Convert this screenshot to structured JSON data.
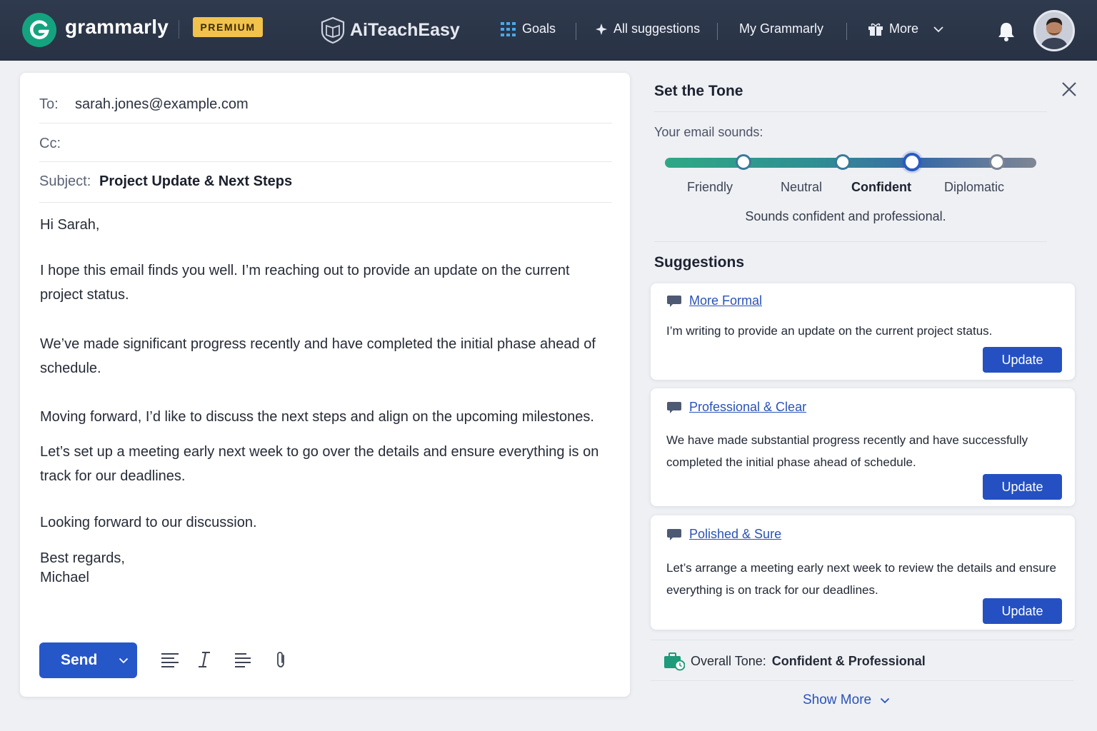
{
  "topbar": {
    "brand": "grammarly",
    "premium_badge": "PREMIUM",
    "partner_brand": "AiTeachEasy",
    "nav": [
      {
        "label": "Goals",
        "icon": "grid-icon"
      },
      {
        "label": "All suggestions",
        "icon": "sparkle-icon"
      },
      {
        "label": "My Grammarly"
      },
      {
        "label": "More",
        "icon": "gift-icon"
      }
    ]
  },
  "email": {
    "to_label": "To:",
    "to_value": "sarah.jones@example.com",
    "cc_label": "Cc:",
    "cc_value": "",
    "subject_label": "Subject:",
    "subject_value": "Project Update & Next Steps",
    "greeting": "Hi Sarah,",
    "paragraphs": [
      "I hope this email finds you well. I’m reaching out to provide an update on the current project status.",
      "We’ve made significant progress recently and have completed the initial phase ahead of schedule.",
      "Moving forward, I’d like to discuss the next steps and align on the upcoming milestones.",
      "Let’s set up a meeting early next week to go over the details and ensure everything is on track for our deadlines.",
      "Looking forward to our discussion."
    ],
    "signoff": "Best regards,",
    "signature": "Michael",
    "send_label": "Send"
  },
  "panel": {
    "title": "Set the Tone",
    "sounds_label": "Your email sounds:",
    "tones": [
      "Friendly",
      "Neutral",
      "Confident",
      "Diplomatic"
    ],
    "active_tone": "Confident",
    "tone_description": "Sounds confident and professional.",
    "suggestions_title": "Suggestions",
    "suggestions": [
      {
        "name": "More Formal",
        "text": "I’m writing to provide an update on the current project status.",
        "button": "Update"
      },
      {
        "name": "Professional & Clear",
        "text": "We have made substantial progress recently and have successfully completed the initial phase ahead of schedule.",
        "button": "Update"
      },
      {
        "name": "Polished & Sure",
        "text": "Let’s arrange a meeting early next week to review the details and ensure everything is on track for our deadlines.",
        "button": "Update"
      }
    ],
    "overall_label": "Overall Tone:",
    "overall_value": "Confident & Professional",
    "show_more": "Show More"
  },
  "colors": {
    "accent": "#2657c9",
    "brand_green": "#15a37f",
    "premium": "#f1c24c",
    "topbar": "#2b3547"
  }
}
